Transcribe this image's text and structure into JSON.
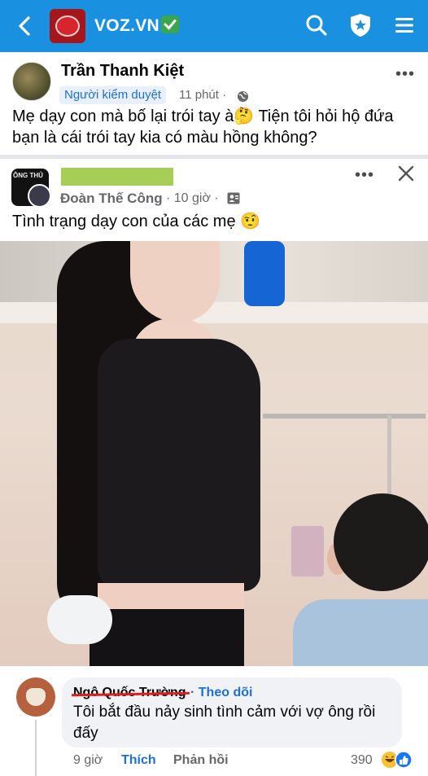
{
  "topbar": {
    "site_title": "VOZ.VN",
    "icons": [
      "back-chevron-icon",
      "voz-logo",
      "check-badge-icon",
      "search-icon",
      "shield-star-icon",
      "menu-icon"
    ],
    "colors": {
      "background": "#1a90e0",
      "logo": "#a7161b",
      "check": "#3aa84a"
    }
  },
  "post1": {
    "author": "Trần Thanh Kiệt",
    "badge": "Người kiểm duyệt",
    "time": "11 phút ·",
    "text": "Mẹ dạy con mà bố lại trói tay à🤔 Tiện tôi hỏi hộ đứa bạn là cái trói tay kia có màu hồng không?",
    "more": "•••"
  },
  "post2": {
    "author": "Đoàn Thế Công",
    "time": "· 10 giờ ·",
    "avatar_text": "ÔNG THỦ",
    "text": "Tình trạng dạy con của các mẹ 🤨",
    "more": "•••",
    "redaction_color": "#a6cd56"
  },
  "comment": {
    "author": "Ngô Quốc Trường",
    "follow": "· Theo dõi",
    "text": "Tôi bắt đầu nảy sinh tình cảm với vợ ông rồi đấy",
    "time": "9 giờ",
    "like": "Thích",
    "reply": "Phản hồi",
    "reaction_count": "390",
    "reactions": [
      "haha-reaction-icon",
      "like-reaction-icon"
    ]
  }
}
